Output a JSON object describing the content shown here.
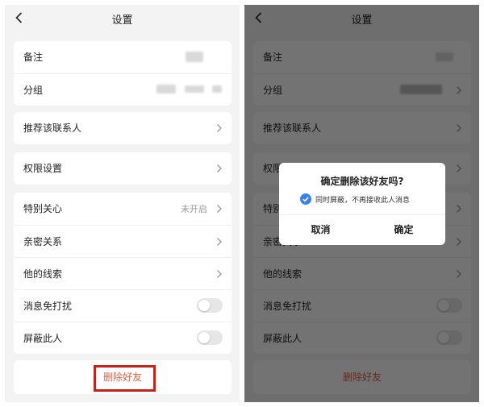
{
  "nav": {
    "title": "设置"
  },
  "remark": {
    "label": "备注"
  },
  "group": {
    "label": "分组"
  },
  "recommend": {
    "label": "推荐该联系人"
  },
  "permissions": {
    "label": "权限设置"
  },
  "special_care": {
    "label": "特别关心",
    "value": "未开启"
  },
  "intimate": {
    "label": "亲密关系"
  },
  "clues": {
    "label": "他的线索"
  },
  "mute": {
    "label": "消息免打扰",
    "on": false
  },
  "block": {
    "label": "屏蔽此人",
    "on": false
  },
  "delete_button": {
    "label": "删除好友"
  },
  "dialog": {
    "title": "确定删除该好友吗?",
    "checkbox_label": "同时屏蔽，不再接收此人消息",
    "checkbox_checked": true,
    "cancel": "取消",
    "confirm": "确定"
  },
  "colors": {
    "accent_red": "#e25d48",
    "highlight_red": "#c2241c",
    "check_blue": "#3b82e6"
  }
}
